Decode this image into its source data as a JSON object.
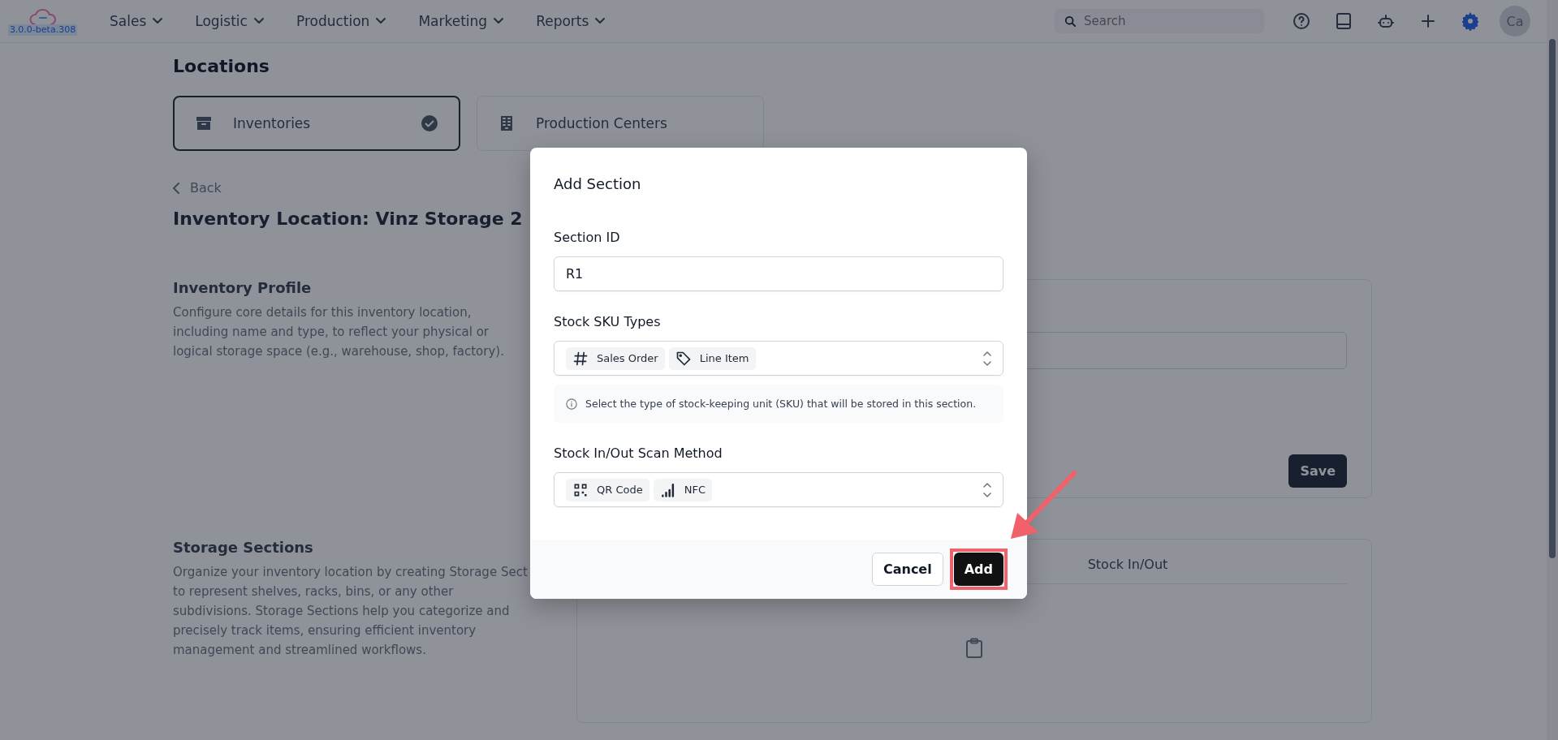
{
  "topbar": {
    "version": "3.0.0-beta.308",
    "nav": [
      "Sales",
      "Logistic",
      "Production",
      "Marketing",
      "Reports"
    ],
    "search": {
      "placeholder": "Search"
    },
    "avatar": "Ca"
  },
  "page": {
    "title": "Locations",
    "location_tabs": [
      {
        "label": "Inventories",
        "kind": "archive",
        "selected": true
      },
      {
        "label": "Production Centers",
        "kind": "building",
        "selected": false
      }
    ],
    "back": "Back",
    "heading": "Inventory Location: Vinz Storage 2",
    "sections": [
      {
        "title": "Inventory Profile",
        "description": "Configure core details for this inventory location, including name and type, to reflect your physical or logical storage space (e.g., warehouse, shop, factory).",
        "kind": "form",
        "button": "Save"
      },
      {
        "title": "Storage Sections",
        "description": "Organize your inventory location by creating Storage Sect to represent shelves, racks, bins, or any other subdivisions. Storage Sections help you categorize and precisely track items, ensuring efficient inventory management and streamlined workflows.",
        "kind": "table",
        "columns": [
          "Stock In/Out"
        ]
      }
    ]
  },
  "dialog": {
    "title": "Add Section",
    "fields": [
      {
        "kind": "text",
        "label": "Section ID",
        "value": "R1"
      },
      {
        "kind": "select",
        "label": "Stock SKU Types",
        "chips": [
          {
            "kind": "hash",
            "label": "Sales Order"
          },
          {
            "kind": "tag",
            "label": "Line Item"
          }
        ],
        "hint": "Select the type of stock-keeping unit (SKU) that will be stored in this section."
      },
      {
        "kind": "select",
        "label": "Stock In/Out Scan Method",
        "chips": [
          {
            "kind": "qr",
            "label": "QR Code"
          },
          {
            "kind": "signal",
            "label": "NFC"
          }
        ]
      }
    ],
    "buttons": [
      {
        "kind": "secondary",
        "label": "Cancel",
        "highlighted": false
      },
      {
        "kind": "primary",
        "label": "Add",
        "highlighted": true
      }
    ]
  }
}
